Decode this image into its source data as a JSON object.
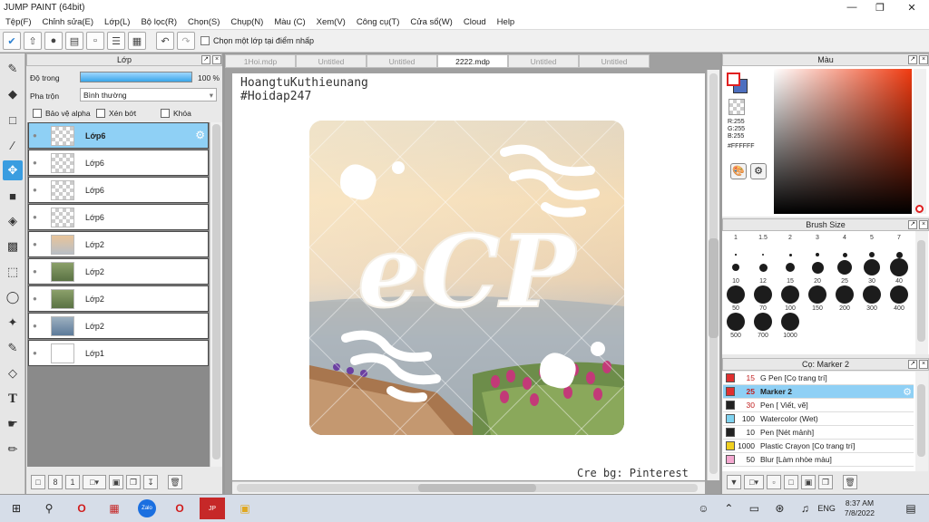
{
  "window": {
    "title": "JUMP PAINT (64bit)"
  },
  "menu": [
    "Tệp(F)",
    "Chỉnh sửa(E)",
    "Lớp(L)",
    "Bộ lọc(R)",
    "Chọn(S)",
    "Chụp(N)",
    "Màu (C)",
    "Xem(V)",
    "Công cụ(T)",
    "Cửa sổ(W)",
    "Cloud",
    "Help"
  ],
  "toolbar": {
    "select_layer_label": "Chọn một lớp tại điểm nhấp"
  },
  "layers": {
    "title": "Lớp",
    "opacity_label": "Độ trong",
    "opacity_value": "100 %",
    "opacity_percent": 100,
    "blend_label": "Pha trộn",
    "blend_value": "Bình thường",
    "protect_alpha": "Bảo vệ alpha",
    "clipping": "Xén bớt",
    "lock": "Khóa",
    "items": [
      {
        "name": "Lớp6",
        "thumb": "transparent",
        "active": true
      },
      {
        "name": "Lớp6",
        "thumb": "transparent"
      },
      {
        "name": "Lớp6",
        "thumb": "transparent"
      },
      {
        "name": "Lớp6",
        "thumb": "transparent"
      },
      {
        "name": "Lớp2",
        "thumb": "sunset"
      },
      {
        "name": "Lớp2",
        "thumb": "green"
      },
      {
        "name": "Lớp2",
        "thumb": "green"
      },
      {
        "name": "Lớp2",
        "thumb": "blue"
      },
      {
        "name": "Lớp1",
        "thumb": "white"
      }
    ]
  },
  "tabs": [
    {
      "label": "1Hoi.mdp",
      "active": false
    },
    {
      "label": "Untitled",
      "active": false
    },
    {
      "label": "Untitled",
      "active": false
    },
    {
      "label": "2222.mdp",
      "active": true
    },
    {
      "label": "Untitled",
      "active": false
    },
    {
      "label": "Untitled",
      "active": false
    }
  ],
  "canvas": {
    "line1": "HoangtuKuthieunang",
    "line2": "#Hoidap247",
    "credit": "Cre bg: Pinterest",
    "logo_text": "eCP"
  },
  "color": {
    "title": "Màu",
    "r": "R:255",
    "g": "G:255",
    "b": "B:255",
    "hex": "#FFFFFF",
    "foreground": "#ffffff",
    "background": "#4d6fbf"
  },
  "brush_size": {
    "title": "Brush Size",
    "sizes": [
      "1",
      "1.5",
      "2",
      "3",
      "4",
      "5",
      "7",
      "10",
      "12",
      "15",
      "20",
      "25",
      "30",
      "40",
      "50",
      "70",
      "100",
      "150",
      "200",
      "300",
      "400",
      "500",
      "700",
      "1000"
    ]
  },
  "brushes": {
    "title": "Cọ: Marker 2",
    "items": [
      {
        "size": "15",
        "name": "G Pen [Cọ trang trí]",
        "color": "#e03030",
        "size_color": "#c02020"
      },
      {
        "size": "25",
        "name": "Marker 2",
        "color": "#e03030",
        "size_color": "#c02020",
        "active": true
      },
      {
        "size": "30",
        "name": "Pen [ Viết, vẽ]",
        "color": "#222222",
        "size_color": "#c02020"
      },
      {
        "size": "100",
        "name": "Watercolor (Wet)",
        "color": "#7fd3f0",
        "size_color": "#222222"
      },
      {
        "size": "10",
        "name": "Pen [Nét mảnh]",
        "color": "#222222",
        "size_color": "#222222"
      },
      {
        "size": "1000",
        "name": "Plastic Crayon [Cọ trang trí]",
        "color": "#f0d020",
        "size_color": "#222222"
      },
      {
        "size": "50",
        "name": "Blur [Làm nhòe màu]",
        "color": "#f4a8d0",
        "size_color": "#222222"
      }
    ]
  },
  "taskbar": {
    "time": "8:37 AM",
    "date": "7/8/2022",
    "lang": "ENG"
  }
}
